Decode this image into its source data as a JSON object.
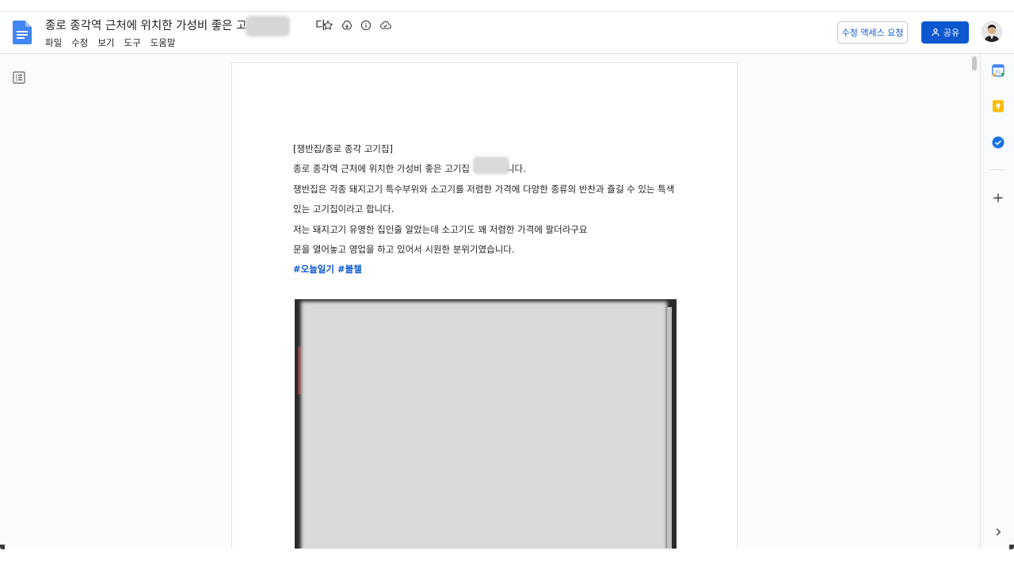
{
  "document": {
    "title": "종로 종각역 근처에 위치한 가성비 좋은 고기집",
    "title_end": "다"
  },
  "menu": [
    "파일",
    "수정",
    "보기",
    "도구",
    "도움말"
  ],
  "header": {
    "request_edit_label": "수정 액세스 요청",
    "share_label": "공유"
  },
  "body": {
    "line1": "[쟁반집/종로 종각 고기집]",
    "line2_start": "종로 종각역 근처에 위치한 가성비 좋은 고기집",
    "line2_end": "니다.",
    "line3": "쟁반집은 각종 돼지고기 특수부위와 소고기를 저렴한 가격에 다양한 종류의 반찬과 즐길 수 있는 특색",
    "line4": "있는 고기집이라고 합니다.",
    "line5": "저는 돼지고기 유명한 집인줄 알았는데 소고기도 꽤 저렴한 가격에 팔더라구요",
    "line6": "문을 열어놓고 영업을 하고 있어서 시원한 분위기였습니다.",
    "hashtags": "#오늘일기 #블챌"
  },
  "icons": {
    "docs_logo": "google-docs-icon",
    "star": "star-icon",
    "move": "move-to-drive-icon",
    "info": "info-icon",
    "cloud": "cloud-saved-icon",
    "outline": "document-outline-icon",
    "calendar": "calendar-icon",
    "keep": "keep-icon",
    "tasks": "tasks-icon",
    "add": "add-icon",
    "expand": "chevron-right-icon"
  },
  "colors": {
    "accent": "#0b57d0",
    "docs_blue": "#4285f4",
    "keep_yellow": "#fbbc04"
  }
}
